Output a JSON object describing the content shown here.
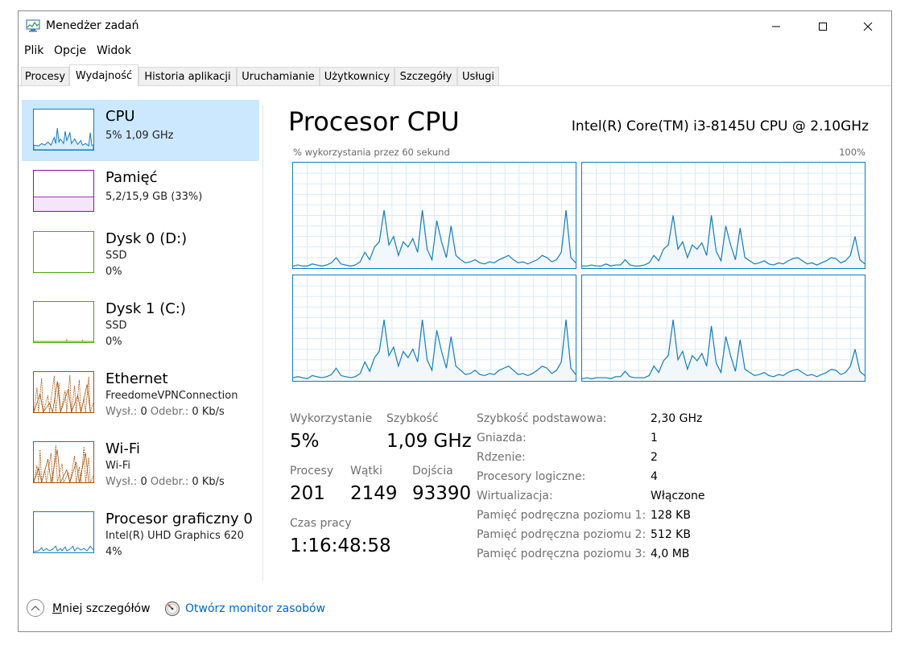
{
  "window": {
    "title": "Menedżer zadań",
    "icon": "task-manager-icon"
  },
  "menu": [
    "Plik",
    "Opcje",
    "Widok"
  ],
  "tabs": [
    "Procesy",
    "Wydajność",
    "Historia aplikacji",
    "Uruchamianie",
    "Użytkownicy",
    "Szczegóły",
    "Usługi"
  ],
  "active_tab": "Wydajność",
  "sidebar": [
    {
      "title": "CPU",
      "line1": "5% 1,09 GHz",
      "line2": "",
      "color": "#117dbb"
    },
    {
      "title": "Pamięć",
      "line1": "5,2/15,9 GB (33%)",
      "line2": "",
      "color": "#8b12ae"
    },
    {
      "title": "Dysk 0 (D:)",
      "line1": "SSD",
      "line2": "0%",
      "color": "#4da60c"
    },
    {
      "title": "Dysk 1 (C:)",
      "line1": "SSD",
      "line2": "0%",
      "color": "#4da60c"
    },
    {
      "title": "Ethernet",
      "line1": "FreedomeVPNConnection",
      "line2a": "Wysł.:",
      "line2b": "0",
      "line2c": "Odebr.:",
      "line2d": "0 Kb/s",
      "color": "#a74f01"
    },
    {
      "title": "Wi-Fi",
      "line1": "Wi-Fi",
      "line2a": "Wysł.:",
      "line2b": "0",
      "line2c": "Odebr.:",
      "line2d": "0 Kb/s",
      "color": "#a74f01"
    },
    {
      "title": "Procesor graficzny 0",
      "line1": "Intel(R) UHD Graphics 620",
      "line2": "4%",
      "color": "#117dbb"
    }
  ],
  "main": {
    "title": "Procesor CPU",
    "model": "Intel(R) Core(TM) i3-8145U CPU @ 2.10GHz",
    "graph_caption": "% wykorzystania przez 60 sekund",
    "graph_max": "100%",
    "core_usage": [
      [
        2,
        3,
        2,
        2,
        4,
        3,
        2,
        3,
        5,
        10,
        4,
        3,
        2,
        3,
        6,
        15,
        8,
        20,
        25,
        55,
        22,
        30,
        12,
        25,
        20,
        28,
        15,
        55,
        18,
        8,
        45,
        25,
        10,
        40,
        12,
        8,
        5,
        6,
        8,
        5,
        4,
        6,
        5,
        8,
        10,
        12,
        8,
        5,
        6,
        4,
        6,
        8,
        12,
        10,
        6,
        8,
        15,
        55,
        10,
        5
      ],
      [
        2,
        2,
        3,
        2,
        2,
        4,
        2,
        3,
        3,
        8,
        3,
        2,
        2,
        3,
        5,
        12,
        7,
        18,
        22,
        50,
        18,
        25,
        10,
        22,
        18,
        24,
        12,
        50,
        16,
        7,
        40,
        22,
        8,
        38,
        10,
        7,
        4,
        5,
        7,
        4,
        3,
        5,
        4,
        7,
        9,
        10,
        7,
        4,
        5,
        3,
        5,
        7,
        10,
        9,
        5,
        7,
        12,
        30,
        8,
        4
      ],
      [
        3,
        4,
        3,
        2,
        5,
        4,
        3,
        4,
        6,
        12,
        5,
        4,
        3,
        4,
        7,
        18,
        9,
        22,
        28,
        58,
        24,
        32,
        14,
        28,
        22,
        30,
        18,
        58,
        20,
        10,
        48,
        28,
        12,
        42,
        14,
        10,
        6,
        7,
        10,
        6,
        5,
        7,
        6,
        10,
        12,
        14,
        10,
        6,
        7,
        5,
        7,
        10,
        14,
        12,
        7,
        10,
        18,
        58,
        12,
        6
      ],
      [
        2,
        3,
        2,
        3,
        3,
        3,
        2,
        4,
        4,
        9,
        4,
        3,
        3,
        3,
        5,
        14,
        8,
        19,
        24,
        58,
        20,
        28,
        11,
        24,
        19,
        26,
        14,
        52,
        17,
        8,
        42,
        24,
        9,
        39,
        11,
        8,
        5,
        6,
        8,
        5,
        4,
        6,
        5,
        8,
        10,
        11,
        8,
        5,
        6,
        4,
        6,
        8,
        11,
        10,
        6,
        8,
        14,
        30,
        9,
        5
      ]
    ],
    "stats": {
      "usage_label": "Wykorzystanie",
      "usage_value": "5%",
      "speed_label": "Szybkość",
      "speed_value": "1,09 GHz",
      "processes_label": "Procesy",
      "processes_value": "201",
      "threads_label": "Wątki",
      "threads_value": "2149",
      "handles_label": "Dojścia",
      "handles_value": "93390",
      "uptime_label": "Czas pracy",
      "uptime_value": "1:16:48:58"
    },
    "specs": [
      {
        "label": "Szybkość podstawowa:",
        "value": "2,30 GHz"
      },
      {
        "label": "Gniazda:",
        "value": "1"
      },
      {
        "label": "Rdzenie:",
        "value": "2"
      },
      {
        "label": "Procesory logiczne:",
        "value": "4"
      },
      {
        "label": "Wirtualizacja:",
        "value": "Włączone"
      },
      {
        "label": "Pamięć podręczna poziomu 1:",
        "value": "128 KB"
      },
      {
        "label": "Pamięć podręczna poziomu 2:",
        "value": "512 KB"
      },
      {
        "label": "Pamięć podręczna poziomu 3:",
        "value": "4,0 MB"
      }
    ]
  },
  "footer": {
    "fewer_details_a": "M",
    "fewer_details_b": "niej szczegółów",
    "resource_monitor": "Otwórz monitor zasobów"
  }
}
